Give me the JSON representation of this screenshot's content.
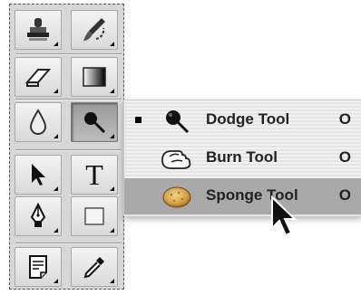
{
  "toolbox": {
    "tools": [
      {
        "id": "stamp",
        "name": "clone-stamp-tool",
        "icon": "stamp-icon"
      },
      {
        "id": "history",
        "name": "history-brush-tool",
        "icon": "history-brush-icon"
      },
      {
        "id": "eraser",
        "name": "eraser-tool",
        "icon": "eraser-icon"
      },
      {
        "id": "gradient",
        "name": "gradient-tool",
        "icon": "gradient-icon"
      },
      {
        "id": "blur",
        "name": "blur-tool",
        "icon": "drop-icon"
      },
      {
        "id": "dodge",
        "name": "dodge-tool-button",
        "icon": "dodge-icon"
      },
      {
        "id": "select",
        "name": "path-selection-tool",
        "icon": "arrow-icon"
      },
      {
        "id": "type",
        "name": "type-tool",
        "icon": "type-icon",
        "glyph": "T"
      },
      {
        "id": "pen",
        "name": "pen-tool",
        "icon": "pen-icon"
      },
      {
        "id": "shape",
        "name": "rectangle-tool",
        "icon": "rectangle-icon"
      },
      {
        "id": "notes",
        "name": "notes-tool",
        "icon": "notes-icon"
      },
      {
        "id": "eyedropper",
        "name": "eyedropper-tool",
        "icon": "eyedropper-icon"
      }
    ]
  },
  "flyout": {
    "items": [
      {
        "label": "Dodge Tool",
        "shortcut": "O",
        "selected": true,
        "highlighted": false,
        "icon": "dodge-icon"
      },
      {
        "label": "Burn Tool",
        "shortcut": "O",
        "selected": false,
        "highlighted": false,
        "icon": "burn-hand-icon"
      },
      {
        "label": "Sponge Tool",
        "shortcut": "O",
        "selected": false,
        "highlighted": true,
        "icon": "sponge-icon"
      }
    ]
  }
}
